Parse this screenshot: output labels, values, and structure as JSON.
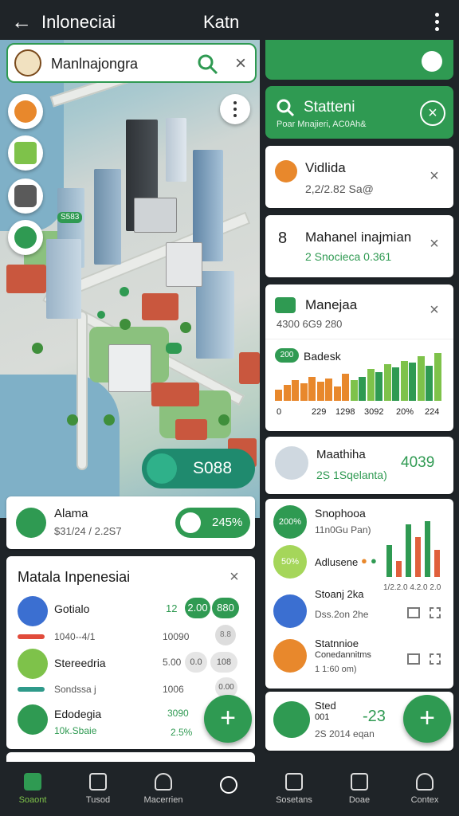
{
  "header": {
    "back_icon": "arrow-left-icon",
    "title_left": "Inloneciai",
    "title_right": "Katn",
    "more_icon": "more-vertical-icon"
  },
  "map": {
    "search": {
      "value": "Manlnajongra",
      "search_icon": "search-icon",
      "close_icon": "close-icon"
    },
    "controls": [
      "compass-icon",
      "tv-icon",
      "camera-icon",
      "leaf-icon"
    ],
    "more_icon": "more-vertical-icon",
    "pins": [
      "S583"
    ],
    "price_pill": {
      "icon": "tag-icon",
      "value": "S088"
    }
  },
  "alama_card": {
    "title": "Alama",
    "subtitle": "$31/24 / 2.2S7",
    "pct": "245%",
    "icon": "bag-icon"
  },
  "matala": {
    "title": "Matala Inpenesiai",
    "rows": [
      {
        "name": "Gotialo",
        "sub": "1040--4/1",
        "value": "12",
        "value2": "10090",
        "chip1": "2.00",
        "chip2": "880",
        "chip3": "8.8"
      },
      {
        "name": "Stereedria",
        "sub": "Sondssa j",
        "value": "5.00",
        "value2": "1006",
        "chip1": "0.0",
        "chip2": "108",
        "chip3": "0.00"
      },
      {
        "name": "Edodegia",
        "sub": "10k.Sbaie",
        "value": "3090",
        "value2": "2.5%"
      }
    ]
  },
  "right": {
    "header": {
      "title": "Statteni",
      "subtitle": "Poar  Mnajieri, AC0Ah&"
    },
    "items": [
      {
        "title": "Vidlida",
        "sub": "2,2/2.82 Sa@"
      },
      {
        "title": "Mahanel inajmian",
        "sub": "2 Snocieca 0.361",
        "num": "8"
      },
      {
        "title": "Manejaa",
        "sub": "4300 6G9 280"
      }
    ],
    "chart": {
      "label": "Badesk",
      "badge": "200",
      "ticks": [
        "0",
        "229",
        "1298",
        "3092",
        "20%",
        "224"
      ]
    },
    "madhina": {
      "title": "Maathiha",
      "sub": "2S 1Sqelanta)",
      "value": "4039"
    },
    "stats": [
      {
        "badge": "200%",
        "title": "Snophooa",
        "sub": "11n0Gu Pan)"
      },
      {
        "badge": "50%",
        "title": "Adlusene",
        "sub": ""
      },
      {
        "title": "Stoanj 2ka",
        "sub": "Dss.2on 2he"
      },
      {
        "title": "Statnnioe",
        "sub": "Conedannitms",
        "sub2": "1 1:60 om)"
      }
    ],
    "mini_chart_label": "1/2.2.0 4.2.0 2.0",
    "sited": {
      "title": "Sted",
      "l1": "001",
      "l2": "2S 2014 eqan",
      "value": "-23"
    }
  },
  "nav": [
    {
      "label": "Soaont",
      "icon": "home-icon"
    },
    {
      "label": "Tusod",
      "icon": "calendar-icon"
    },
    {
      "label": "Macerrien",
      "icon": "profile-icon"
    },
    {
      "label": "",
      "icon": "search-icon"
    },
    {
      "label": "Sosetans",
      "icon": "bag-icon"
    },
    {
      "label": "Doae",
      "icon": "document-icon"
    },
    {
      "label": "Contex",
      "icon": "user-icon"
    }
  ],
  "colors": {
    "accent": "#2f9a52",
    "orange": "#e8882c",
    "dark": "#1f2428",
    "teal": "#1f8a6e"
  }
}
